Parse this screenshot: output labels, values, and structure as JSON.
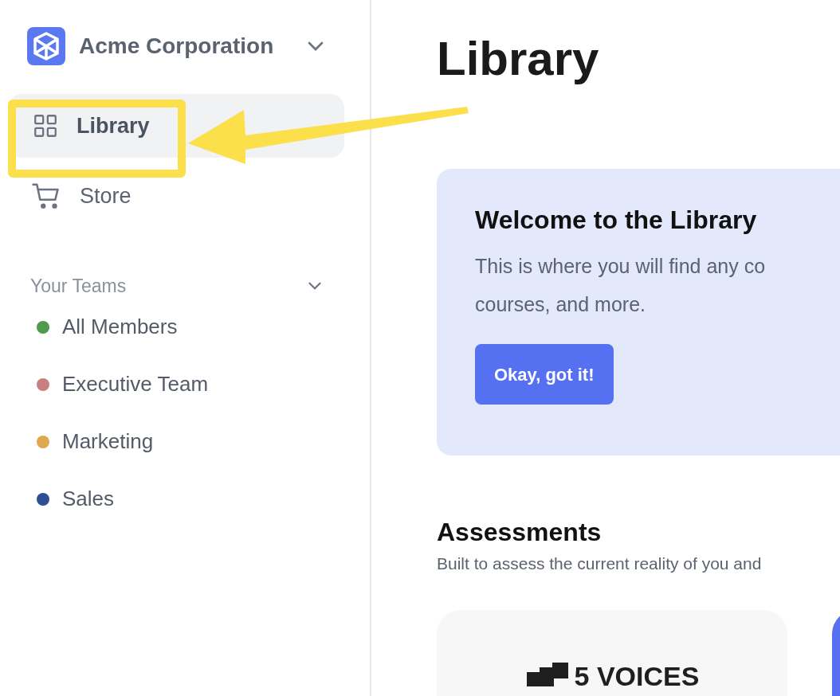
{
  "org": {
    "name": "Acme Corporation"
  },
  "nav": [
    {
      "label": "Library",
      "kind": "grid",
      "selected": true
    },
    {
      "label": "Store",
      "kind": "cart",
      "selected": false
    }
  ],
  "teams": {
    "heading": "Your Teams",
    "items": [
      {
        "name": "All Members",
        "color": "#4e9a4e"
      },
      {
        "name": "Executive Team",
        "color": "#c97f7f"
      },
      {
        "name": "Marketing",
        "color": "#dfa84f"
      },
      {
        "name": "Sales",
        "color": "#2f4f94"
      }
    ]
  },
  "page_title": "Library",
  "welcome": {
    "title": "Welcome to the Library",
    "lines": [
      "This is where you will find any co",
      "courses, and more."
    ],
    "button": "Okay, got it!"
  },
  "assessments": {
    "title": "Assessments",
    "subtitle": "Built to assess the current reality of you and",
    "cards": [
      {
        "logo": "5 VOICES"
      }
    ]
  }
}
